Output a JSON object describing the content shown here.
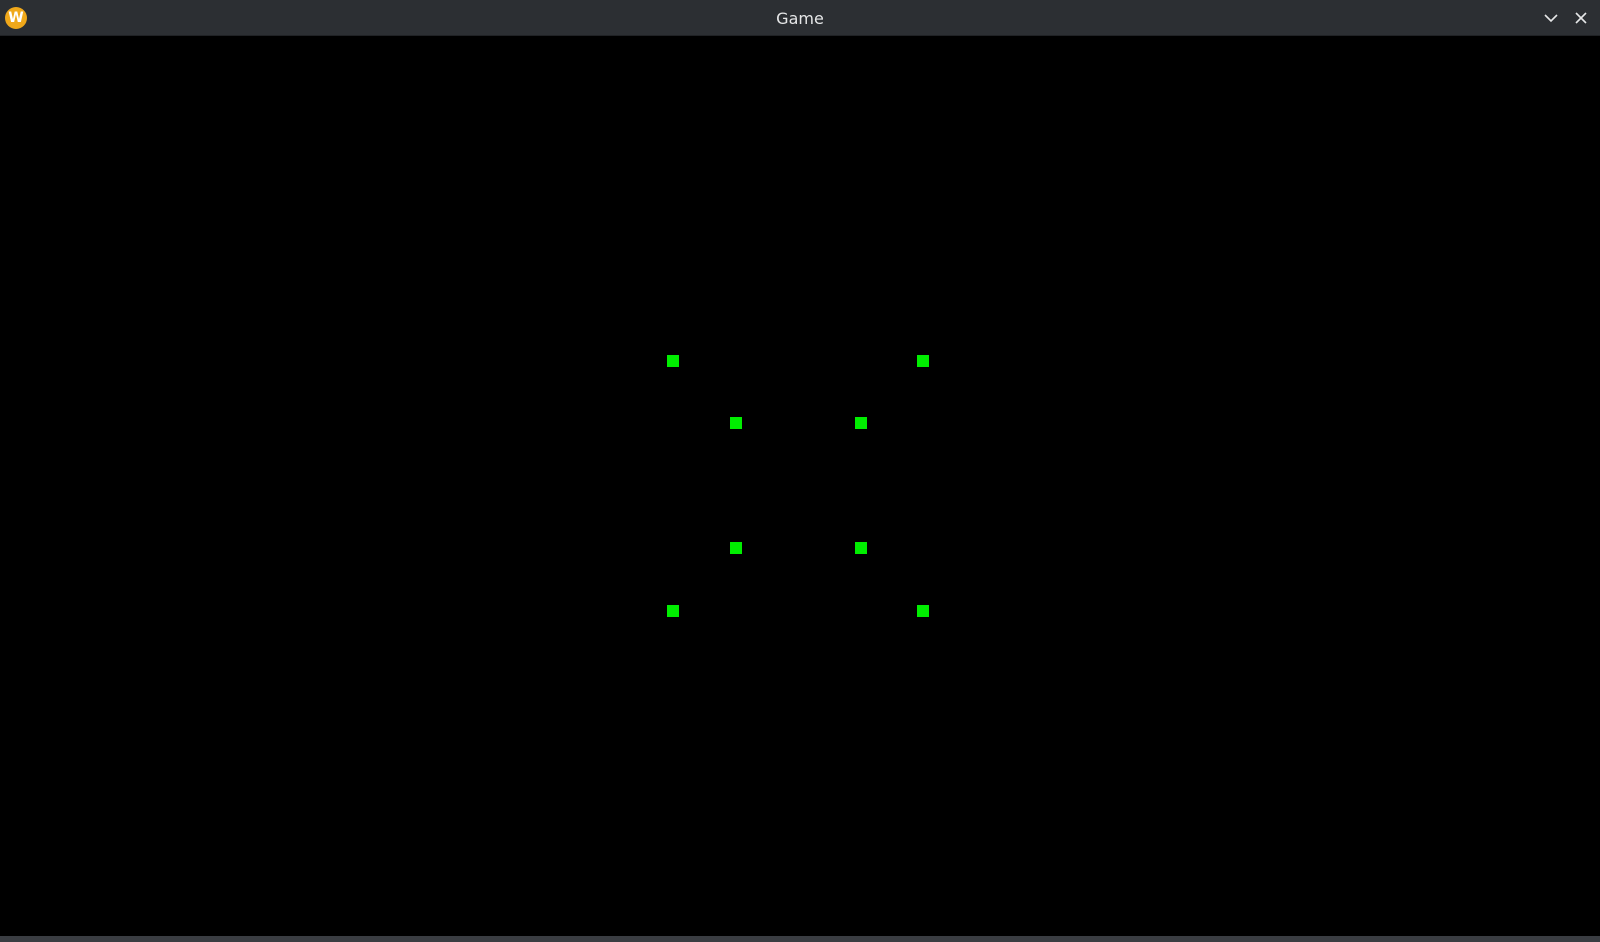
{
  "window": {
    "title": "Game",
    "logo_letter": "W",
    "logo_color": "#f0a81a",
    "titlebar_color": "#2c2f33",
    "controls": [
      {
        "name": "minimize",
        "icon": "chevron-down-icon"
      },
      {
        "name": "close",
        "icon": "close-icon"
      }
    ]
  },
  "game": {
    "background_color": "#000000",
    "sprite_color": "#00ee00"
  }
}
